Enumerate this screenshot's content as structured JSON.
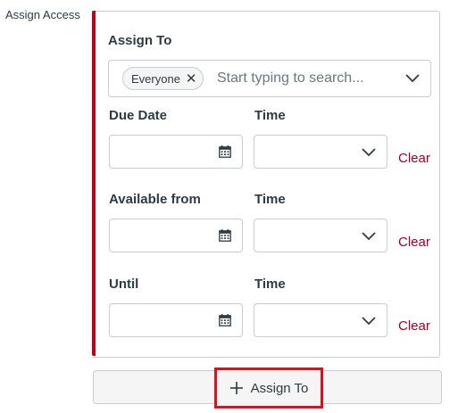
{
  "section_label": "Assign Access",
  "assign_to": {
    "label": "Assign To",
    "selected_pill": "Everyone",
    "placeholder": "Start typing to search..."
  },
  "rows": [
    {
      "date_label": "Due Date",
      "time_label": "Time",
      "date_value": "",
      "time_value": "",
      "clear_label": "Clear"
    },
    {
      "date_label": "Available from",
      "time_label": "Time",
      "date_value": "",
      "time_value": "",
      "clear_label": "Clear"
    },
    {
      "date_label": "Until",
      "time_label": "Time",
      "date_value": "",
      "time_value": "",
      "clear_label": "Clear"
    }
  ],
  "add_button": {
    "label": "Assign To"
  },
  "colors": {
    "accent": "#c00013",
    "clear_link": "#a0002a",
    "highlight_border": "#d6141d",
    "text": "#2d3b45"
  },
  "icons": {
    "remove": "x-icon",
    "dropdown": "chevron-down-icon",
    "calendar": "calendar-icon",
    "add": "plus-icon"
  }
}
